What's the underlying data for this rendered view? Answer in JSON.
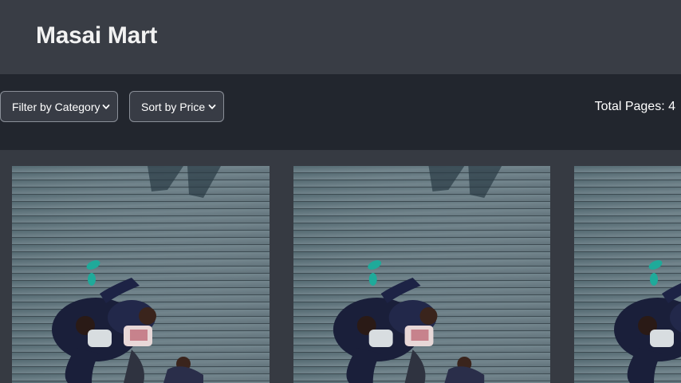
{
  "header": {
    "brand": "Masai Mart"
  },
  "toolbar": {
    "category_select": {
      "selected": "Filter by Category",
      "icon": "chevron-down-icon"
    },
    "price_select": {
      "selected": "Sort by Price",
      "icon": "chevron-down-icon"
    },
    "total_pages_label": "Total Pages: 4"
  },
  "products": [
    {
      "image": "aerial-photo-people-sitting-on-boardwalk"
    },
    {
      "image": "aerial-photo-people-sitting-on-boardwalk"
    },
    {
      "image": "aerial-photo-people-sitting-on-boardwalk"
    }
  ],
  "colors": {
    "header_bg": "#393d45",
    "toolbar_bg": "#22262e",
    "page_bg": "#363a42",
    "text": "#f2f2f2"
  }
}
